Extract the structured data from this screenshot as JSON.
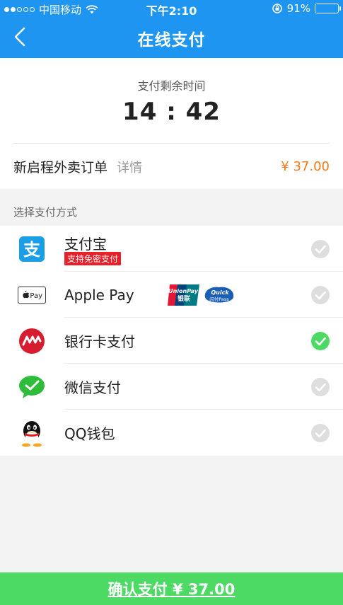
{
  "status_bar": {
    "carrier": "中国移动",
    "time": "下午2:10",
    "battery_percent": "91%",
    "battery_level": 0.91
  },
  "nav": {
    "title": "在线支付"
  },
  "timer": {
    "label": "支付剩余时间",
    "countdown": "14 : 42"
  },
  "order": {
    "name": "新启程外卖订单",
    "detail": "详情",
    "price": "¥ 37.00"
  },
  "section_label": "选择支付方式",
  "methods": [
    {
      "label": "支付宝",
      "badge": "支持免密支付",
      "selected": false,
      "icon": "alipay-icon"
    },
    {
      "label": "Apple Pay",
      "selected": false,
      "icon": "apple-pay-icon"
    },
    {
      "label": "银行卡支付",
      "selected": true,
      "icon": "bank-card-icon"
    },
    {
      "label": "微信支付",
      "selected": false,
      "icon": "wechat-icon"
    },
    {
      "label": "QQ钱包",
      "selected": false,
      "icon": "qq-icon"
    }
  ],
  "unionpay": {
    "logo_top": "UnionPay",
    "logo_bottom": "银联",
    "quickpass_top": "Quick",
    "quickpass_bottom": "闪付Pass"
  },
  "confirm_button": "确认支付 ¥ 37.00",
  "colors": {
    "primary": "#1e96f1",
    "confirm": "#4cd964",
    "price": "#f57a17",
    "badge": "#e6212a",
    "check_selected": "#4cd964",
    "check_unselected": "#dedede"
  }
}
